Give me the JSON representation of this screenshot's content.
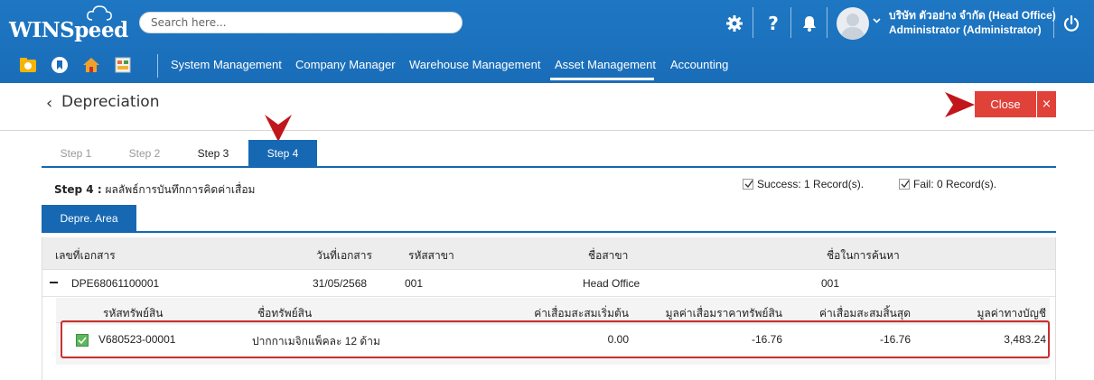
{
  "app": {
    "logo_text": "WINSpeed",
    "search_placeholder": "Search here...",
    "company": "บริษัท ตัวอย่าง จำกัด (Head Office)",
    "user": "Administrator (Administrator)",
    "brand_color": "#1a6db8"
  },
  "header_icons": [
    "gear-icon",
    "help-icon",
    "bell-icon",
    "avatar",
    "power-icon"
  ],
  "nav": {
    "quick_icons": [
      "folder-icon",
      "bookmark-icon",
      "home-icon",
      "dashboard-icon"
    ],
    "items": [
      {
        "label": "System Management"
      },
      {
        "label": "Company Manager"
      },
      {
        "label": "Warehouse Management"
      },
      {
        "label": "Asset Management",
        "active": true
      },
      {
        "label": "Accounting"
      }
    ]
  },
  "page": {
    "title": "Depreciation",
    "close_label": "Close",
    "close_x": "×"
  },
  "steps": [
    {
      "label": "Step 1",
      "state": "done"
    },
    {
      "label": "Step 2",
      "state": "done"
    },
    {
      "label": "Step 3",
      "state": "normal"
    },
    {
      "label": "Step 4",
      "state": "active"
    }
  ],
  "result": {
    "step_prefix": "Step 4 :",
    "step_desc": "ผลลัพธ์การบันทึกการคิดค่าเสื่อม",
    "success_text": "Success:  1  Record(s).",
    "fail_text": "Fail:  0  Record(s)."
  },
  "area_tab": "Depre. Area",
  "grid": {
    "headers": [
      "เลขที่เอกสาร",
      "วันที่เอกสาร",
      "รหัสสาขา",
      "ชื่อสาขา",
      "ชื่อในการค้นหา"
    ],
    "row": {
      "doc_no": "DPE68061100001",
      "doc_date": "31/05/2568",
      "branch_code": "001",
      "branch_name": "Head Office",
      "search_name": "001"
    },
    "sub_headers": [
      "รหัสทรัพย์สิน",
      "ชื่อทรัพย์สิน",
      "ค่าเสื่อมสะสมเริ่มต้น",
      "มูลค่าเสื่อมราคาทรัพย์สิน",
      "ค่าเสื่อมสะสมสิ้นสุด",
      "มูลค่าทางบัญชี"
    ],
    "sub_row": {
      "asset_code": "V680523-00001",
      "asset_name": "ปากกาเมจิกแพ็คละ 12 ด้าม",
      "begin_accum": "0.00",
      "depre_value": "-16.76",
      "end_accum": "-16.76",
      "book_value": "3,483.24"
    }
  }
}
